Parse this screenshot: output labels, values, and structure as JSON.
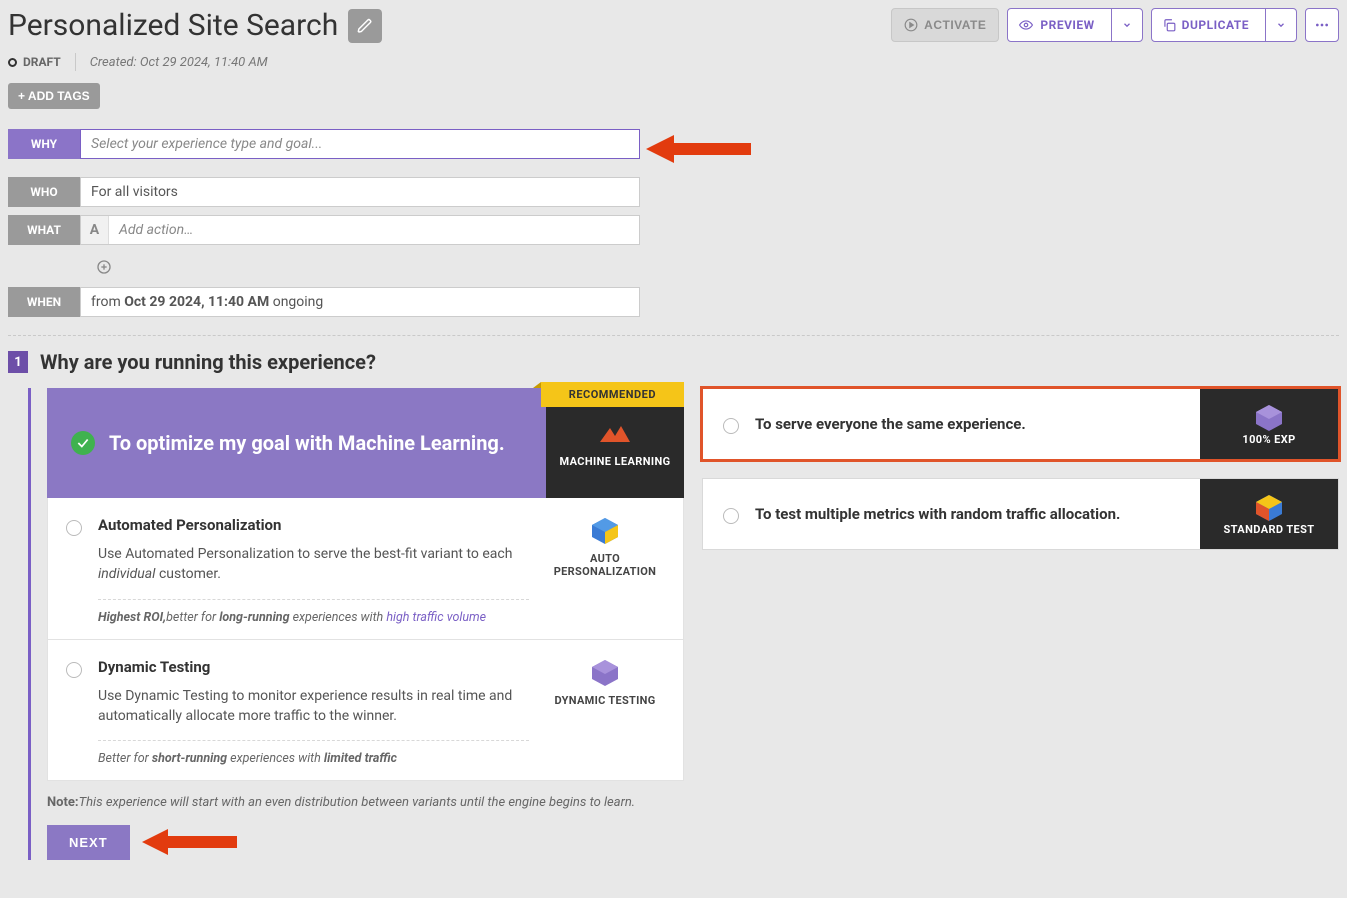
{
  "header": {
    "title": "Personalized Site Search",
    "status": "DRAFT",
    "created_label": "Created:",
    "created_value": "Oct 29 2024, 11:40 AM",
    "add_tags": "+ ADD TAGS",
    "activate": "ACTIVATE",
    "preview": "PREVIEW",
    "duplicate": "DUPLICATE"
  },
  "builder": {
    "why": {
      "label": "WHY",
      "placeholder": "Select your experience type and goal..."
    },
    "who": {
      "label": "WHO",
      "value": "For all visitors"
    },
    "what": {
      "label": "WHAT",
      "prefix": "A",
      "placeholder": "Add action…"
    },
    "when": {
      "label": "WHEN",
      "prefix_text": "from ",
      "bold": "Oct 29 2024, 11:40 AM",
      "suffix_text": " ongoing"
    }
  },
  "step": {
    "num": "1",
    "title": "Why are you running this experience?"
  },
  "primary": {
    "recommended": "RECOMMENDED",
    "headline": "To optimize my goal with Machine Learning.",
    "badge": "MACHINE LEARNING"
  },
  "options": {
    "auto": {
      "title": "Automated Personalization",
      "desc_a": "Use Automated Personalization to serve the best-fit variant to each ",
      "desc_em": "individual",
      "desc_b": " customer.",
      "side": "AUTO PERSONALIZATION",
      "foot_a": "Highest ROI,",
      "foot_b": "better for ",
      "foot_bold": "long-running",
      "foot_c": " experiences with ",
      "foot_link": "high traffic volume"
    },
    "dyn": {
      "title": "Dynamic Testing",
      "desc": "Use Dynamic Testing to monitor experience results in real time and automatically allocate more traffic to the winner.",
      "side": "DYNAMIC TESTING",
      "foot_a": "Better for ",
      "foot_bold1": "short-running",
      "foot_b": " experiences with ",
      "foot_bold2": "limited traffic"
    }
  },
  "right": {
    "same": {
      "text": "To serve everyone the same experience.",
      "side": "100% EXP"
    },
    "test": {
      "text": "To test multiple metrics with random traffic allocation.",
      "side": "STANDARD TEST"
    }
  },
  "note": {
    "label": "Note:",
    "text": "This experience will start with an even distribution between variants until the engine begins to learn."
  },
  "next": "NEXT",
  "colors": {
    "accent": "#7a5fc5",
    "arrow": "#e23b0e"
  }
}
